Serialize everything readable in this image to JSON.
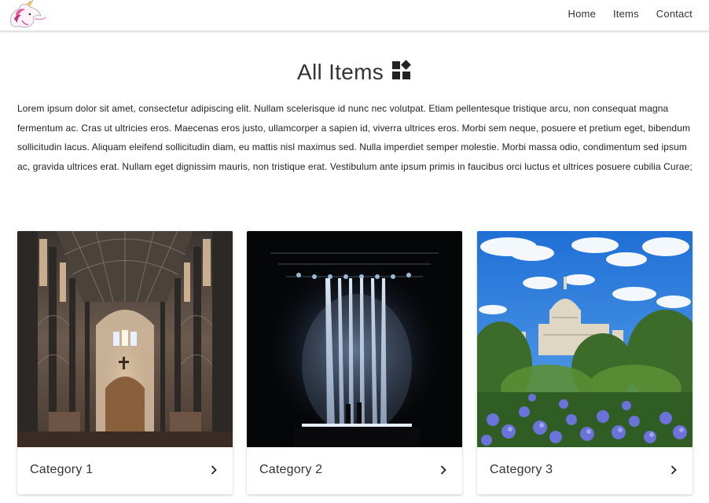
{
  "nav": {
    "logo": "unicorn-logo",
    "links": [
      "Home",
      "Items",
      "Contact"
    ]
  },
  "page": {
    "title": "All Items",
    "title_icon": "widgets-icon",
    "intro": "Lorem ipsum dolor sit amet, consectetur adipiscing elit. Nullam scelerisque id nunc nec volutpat. Etiam pellentesque tristique arcu, non consequat magna fermentum ac. Cras ut ultricies eros. Maecenas eros justo, ullamcorper a sapien id, viverra ultrices eros. Morbi sem neque, posuere et pretium eget, bibendum sollicitudin lacus. Aliquam eleifend sollicitudin diam, eu mattis nisl maximus sed. Nulla imperdiet semper molestie. Morbi massa odio, condimentum sed ipsum ac, gravida ultrices erat. Nullam eget dignissim mauris, non tristique erat. Vestibulum ante ipsum primis in faucibus orci luctus et ultrices posuere cubilia Curae;"
  },
  "cards": [
    {
      "label": "Category 1",
      "image": "church-interior-photo",
      "icon": "chevron-right-icon"
    },
    {
      "label": "Category 2",
      "image": "concert-lights-photo",
      "icon": "chevron-right-icon"
    },
    {
      "label": "Category 3",
      "image": "cathedral-garden-photo",
      "icon": "chevron-right-icon"
    }
  ],
  "colors": {
    "text": "#333333",
    "card_shadow": "#cccccc",
    "background": "#ffffff"
  }
}
